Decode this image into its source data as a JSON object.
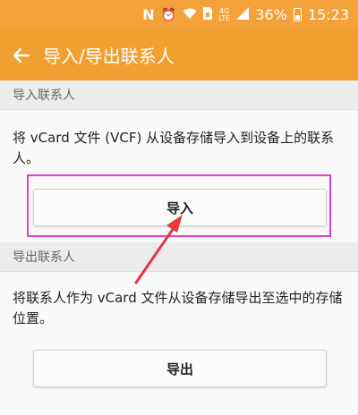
{
  "status_bar": {
    "icons": [
      "notification-n-icon",
      "alarm-icon",
      "wifi-icon",
      "sim-icon",
      "lte-icon",
      "signal-icon",
      "battery-icon"
    ],
    "lte_top": "4G",
    "lte_bottom": "LTE",
    "battery": "36%",
    "time": "15:23"
  },
  "header": {
    "title": "导入/导出联系人",
    "back_icon": "arrow-left-icon"
  },
  "import_section": {
    "header": "导入联系人",
    "description": "将 vCard 文件 (VCF) 从设备存储导入到设备上的联系人。",
    "button_label": "导入"
  },
  "export_section": {
    "header": "导出联系人",
    "description": "将联系人作为 vCard 文件从设备存储导出至选中的存储位置。",
    "button_label": "导出"
  },
  "colors": {
    "accent": "#f0a030",
    "highlight": "#e23fd0",
    "annotation_arrow": "#e8383d"
  }
}
